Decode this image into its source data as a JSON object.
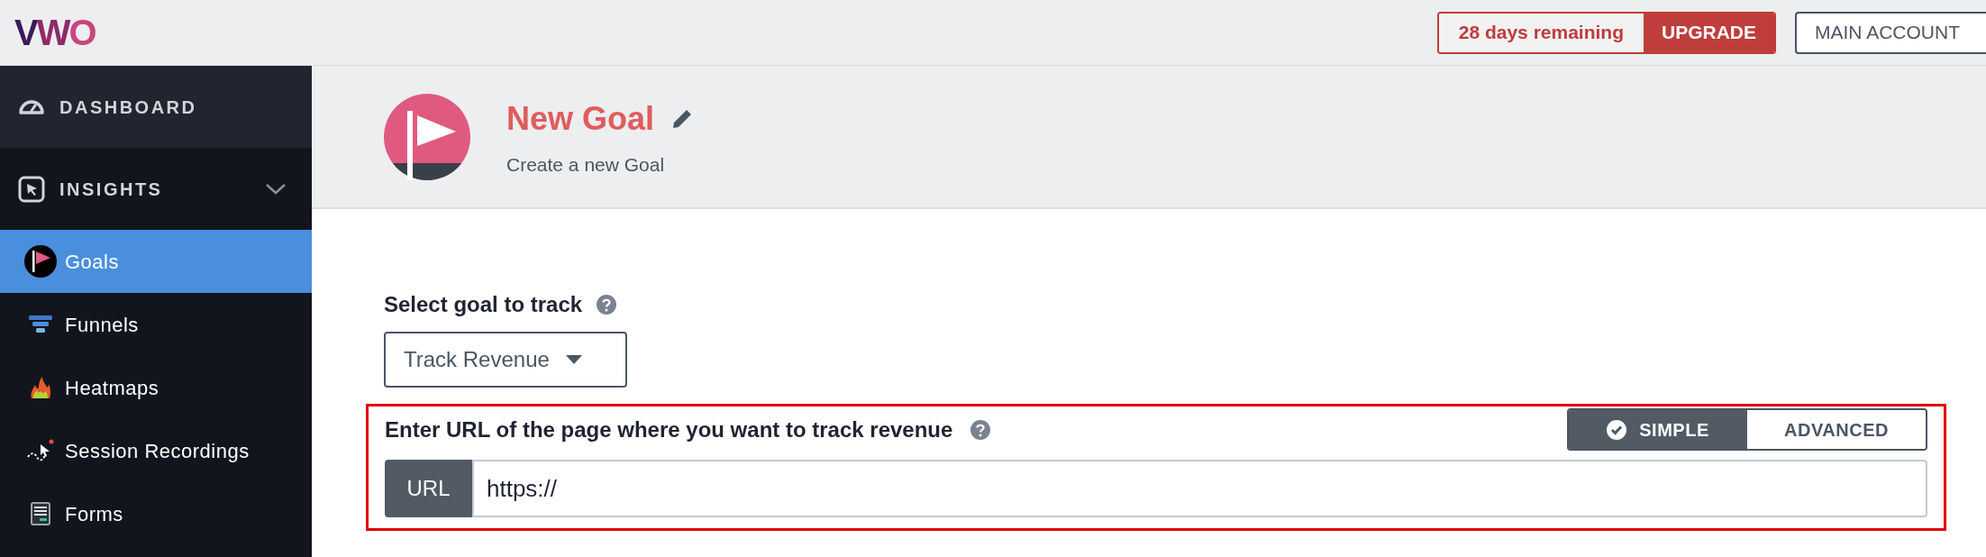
{
  "logo": "VWO",
  "trial": {
    "remaining": "28 days remaining",
    "upgrade": "UPGRADE"
  },
  "account_button": "MAIN ACCOUNT",
  "sidebar": {
    "items": [
      {
        "label": "DASHBOARD",
        "selected": false
      },
      {
        "label": "INSIGHTS",
        "selected": false,
        "expanded": true,
        "children": [
          {
            "label": "Goals",
            "kind": "goals",
            "selected": true
          },
          {
            "label": "Funnels",
            "kind": "funnels",
            "selected": false
          },
          {
            "label": "Heatmaps",
            "kind": "heatmaps",
            "selected": false
          },
          {
            "label": "Session Recordings",
            "kind": "recordings",
            "selected": false
          },
          {
            "label": "Forms",
            "kind": "forms",
            "selected": false
          }
        ]
      }
    ]
  },
  "header": {
    "title": "New Goal",
    "subtitle": "Create a new Goal"
  },
  "goal_select": {
    "label": "Select goal to track",
    "value": "Track Revenue"
  },
  "url_section": {
    "highlighted": true,
    "label": "Enter URL of the page where you want to track revenue",
    "modes": [
      {
        "label": "SIMPLE",
        "selected": true
      },
      {
        "label": "ADVANCED",
        "selected": false
      }
    ],
    "addon": "URL",
    "value": "https://"
  }
}
